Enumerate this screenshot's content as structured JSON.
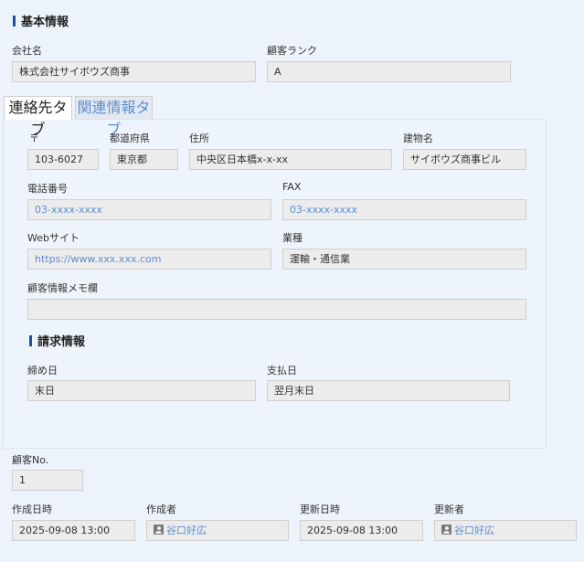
{
  "basic_info": {
    "title": "基本情報",
    "company_label": "会社名",
    "company_value": "株式会社サイボウズ商事",
    "rank_label": "顧客ランク",
    "rank_value": "A"
  },
  "tabs": [
    {
      "label": "連絡先タブ"
    },
    {
      "label": "関連情報タブ"
    }
  ],
  "contact": {
    "zip_label": "〒",
    "zip_value": "103-6027",
    "pref_label": "都道府県",
    "pref_value": "東京都",
    "address_label": "住所",
    "address_value": "中央区日本橋x-x-xx",
    "building_label": "建物名",
    "building_value": "サイボウズ商事ビル",
    "phone_label": "電話番号",
    "phone_value": "03-xxxx-xxxx",
    "fax_label": "FAX",
    "fax_value": "03-xxxx-xxxx",
    "web_label": "Webサイト",
    "web_value": "https://www.xxx.xxx.com",
    "industry_label": "業種",
    "industry_value": "運輸・通信業",
    "memo_label": "顧客情報メモ欄",
    "memo_value": ""
  },
  "billing": {
    "title": "請求情報",
    "closing_label": "締め日",
    "closing_value": "末日",
    "payment_label": "支払日",
    "payment_value": "翌月末日"
  },
  "meta": {
    "customer_no_label": "顧客No.",
    "customer_no_value": "1",
    "created_at_label": "作成日時",
    "created_at_value": "2025-09-08 13:00",
    "creator_label": "作成者",
    "creator_value": "谷口好広",
    "updated_at_label": "更新日時",
    "updated_at_value": "2025-09-08 13:00",
    "updater_label": "更新者",
    "updater_value": "谷口好広"
  },
  "icons": {
    "user": "user-icon"
  },
  "colors": {
    "accent": "#1f4ea3",
    "link": "#5b8ed0",
    "background": "#edf3fb"
  }
}
